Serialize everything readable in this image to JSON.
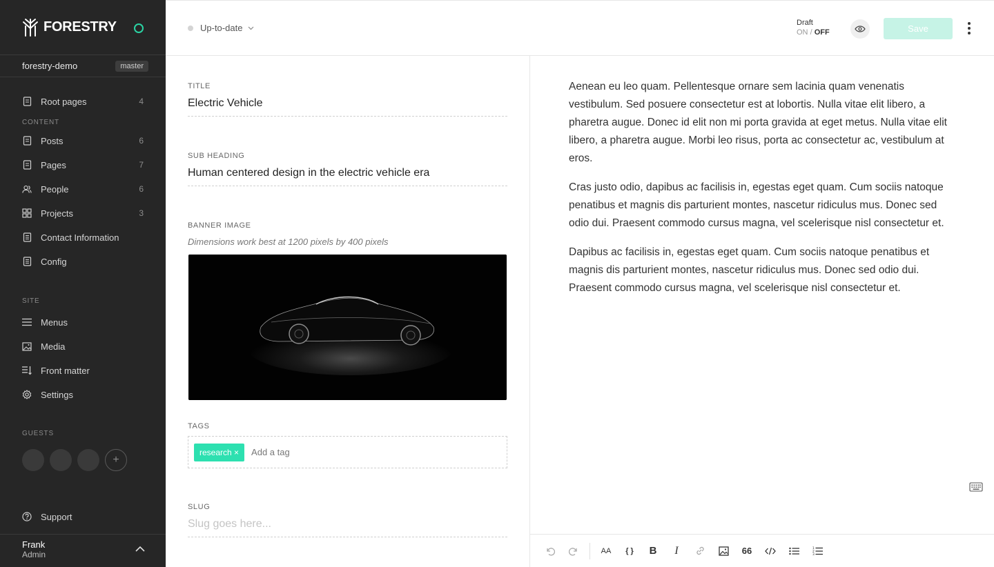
{
  "brand": {
    "name": "FORESTRY",
    "accent": "#2bd4a4"
  },
  "site": {
    "name": "forestry-demo",
    "branch": "master"
  },
  "nav": {
    "root": {
      "label": "Root pages",
      "count": "4",
      "icon": "document-icon"
    },
    "content_label": "CONTENT",
    "content": [
      {
        "label": "Posts",
        "count": "6",
        "icon": "document-icon"
      },
      {
        "label": "Pages",
        "count": "7",
        "icon": "document-icon"
      },
      {
        "label": "People",
        "count": "6",
        "icon": "people-icon"
      },
      {
        "label": "Projects",
        "count": "3",
        "icon": "grid-icon"
      },
      {
        "label": "Contact Information",
        "count": "",
        "icon": "file-icon"
      },
      {
        "label": "Config",
        "count": "",
        "icon": "file-icon"
      }
    ],
    "site_label": "SITE",
    "site": [
      {
        "label": "Menus",
        "icon": "menu-icon"
      },
      {
        "label": "Media",
        "icon": "image-icon"
      },
      {
        "label": "Front matter",
        "icon": "front-matter-icon"
      },
      {
        "label": "Settings",
        "icon": "gear-icon"
      }
    ],
    "guests_label": "GUESTS",
    "support": "Support"
  },
  "user": {
    "name": "Frank",
    "role": "Admin"
  },
  "topbar": {
    "sync_status": "Up-to-date",
    "draft_label": "Draft",
    "draft_on": "ON",
    "draft_sep": "/",
    "draft_off": "OFF",
    "save_label": "Save"
  },
  "form": {
    "title_label": "TITLE",
    "title_value": "Electric Vehicle",
    "subheading_label": "SUB HEADING",
    "subheading_value": "Human centered design in the electric vehicle era",
    "banner_label": "BANNER IMAGE",
    "banner_hint": "Dimensions work best at 1200 pixels by 400 pixels",
    "tags_label": "TAGS",
    "tags": [
      "research"
    ],
    "tag_remove": "×",
    "tag_placeholder": "Add a tag",
    "slug_label": "SLUG",
    "slug_placeholder": "Slug goes here..."
  },
  "editor": {
    "paragraphs": [
      "Aenean eu leo quam. Pellentesque ornare sem lacinia quam venenatis vestibulum. Sed posuere consectetur est at lobortis. Nulla vitae elit libero, a pharetra augue. Donec id elit non mi porta gravida at eget metus. Nulla vitae elit libero, a pharetra augue. Morbi leo risus, porta ac consectetur ac, vestibulum at eros.",
      "Cras justo odio, dapibus ac facilisis in, egestas eget quam. Cum sociis natoque penatibus et magnis dis parturient montes, nascetur ridiculus mus. Donec sed odio dui. Praesent commodo cursus magna, vel scelerisque nisl consectetur et.",
      "Dapibus ac facilisis in, egestas eget quam. Cum sociis natoque penatibus et magnis dis parturient montes, nascetur ridiculus mus. Donec sed odio dui. Praesent commodo cursus magna, vel scelerisque nisl consectetur et."
    ]
  },
  "toolbar": {
    "buttons": [
      "undo-icon",
      "redo-icon",
      "text-size-icon",
      "braces-icon",
      "bold-icon",
      "italic-icon",
      "link-icon",
      "image-icon",
      "quote-icon",
      "code-icon",
      "bullet-list-icon",
      "numbered-list-icon"
    ],
    "bold": "B",
    "italic": "I",
    "braces": "{ }",
    "quote": "66",
    "text_size": "AA"
  }
}
